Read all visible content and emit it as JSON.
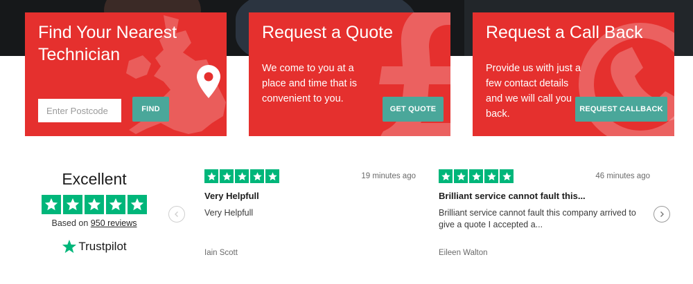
{
  "cards": {
    "find": {
      "title_line1": "Find Your Nearest",
      "title_line2": "Technician",
      "postcode_placeholder": "Enter Postcode",
      "postcode_value": "",
      "button_label": "FIND"
    },
    "quote": {
      "title": "Request a Quote",
      "text": "We come to you at a place and time that is convenient to you.",
      "button_label": "GET QUOTE"
    },
    "callback": {
      "title": "Request a Call Back",
      "text": "Provide us with just a few contact details and we will call you back.",
      "button_label": "REQUEST CALLBACK"
    }
  },
  "trustpilot": {
    "rating_word": "Excellent",
    "stars": 5,
    "based_on_prefix": "Based on",
    "reviews_link": "950 reviews",
    "brand": "Trustpilot",
    "reviews": [
      {
        "stars": 5,
        "time": "19 minutes ago",
        "title": "Very Helpfull",
        "body": "Very Helpfull",
        "author": "Iain Scott"
      },
      {
        "stars": 5,
        "time": "46 minutes ago",
        "title": "Brilliant service cannot fault this...",
        "body": "Brilliant service cannot fault this company arrived to give a quote I accepted a...",
        "author": "Eileen Walton"
      }
    ]
  },
  "colors": {
    "card_red": "#e5302e",
    "button_teal": "#4aa79a",
    "trustpilot_green": "#00b67a"
  },
  "icons": {
    "map_pin": "location-pin-icon",
    "pound": "pound-sign-icon",
    "phone": "phone-icon",
    "star": "star-icon",
    "prev": "chevron-left-icon",
    "next": "chevron-right-icon"
  }
}
